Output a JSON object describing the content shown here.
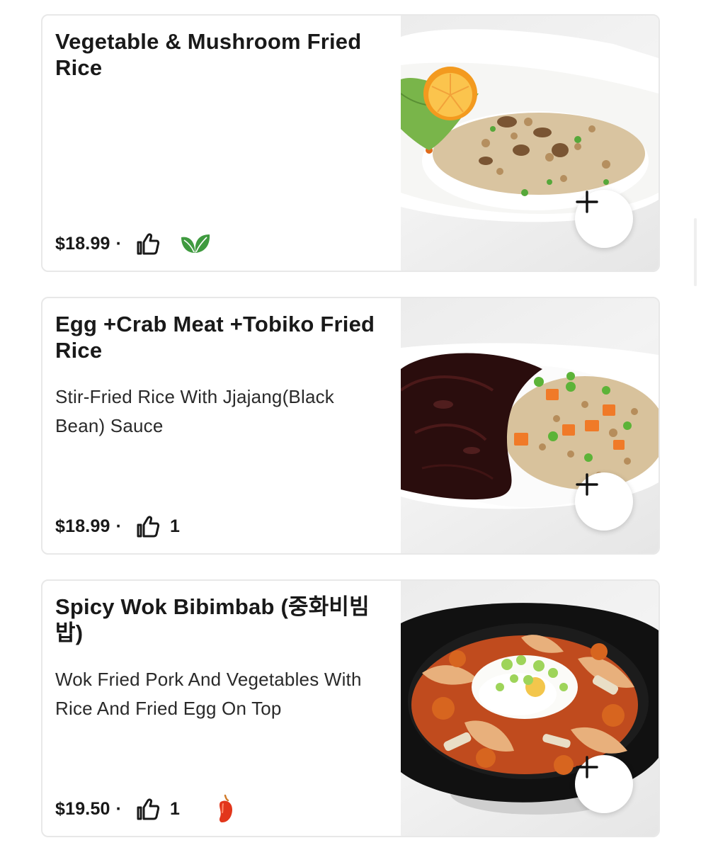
{
  "menu": {
    "items": [
      {
        "title": "Vegetable & Mushroom Fried Rice",
        "description": "",
        "price": "$18.99",
        "separator": "·",
        "likes": "",
        "badge": "vegetarian-leaf-icon",
        "image": "vegetable-mushroom-fried-rice-photo",
        "add_label": "+"
      },
      {
        "title": "Egg +Crab Meat +Tobiko Fried Rice",
        "description": "Stir-Fried Rice With Jjajang(Black Bean) Sauce",
        "price": "$18.99",
        "separator": "·",
        "likes": "1",
        "badge": "",
        "image": "jjajang-fried-rice-photo",
        "add_label": "+"
      },
      {
        "title": "Spicy Wok Bibimbab (중화비빔밥)",
        "description": "Wok Fried Pork And Vegetables With Rice And Fried Egg On Top",
        "price": "$19.50",
        "separator": "·",
        "likes": "1",
        "badge": "spicy-pepper-icon",
        "image": "spicy-wok-bibimbab-photo",
        "add_label": "+"
      }
    ]
  },
  "colors": {
    "text": "#191919",
    "border": "#e8e8e8",
    "leaf": "#3f9a3f",
    "pepper": "#e2361b"
  }
}
